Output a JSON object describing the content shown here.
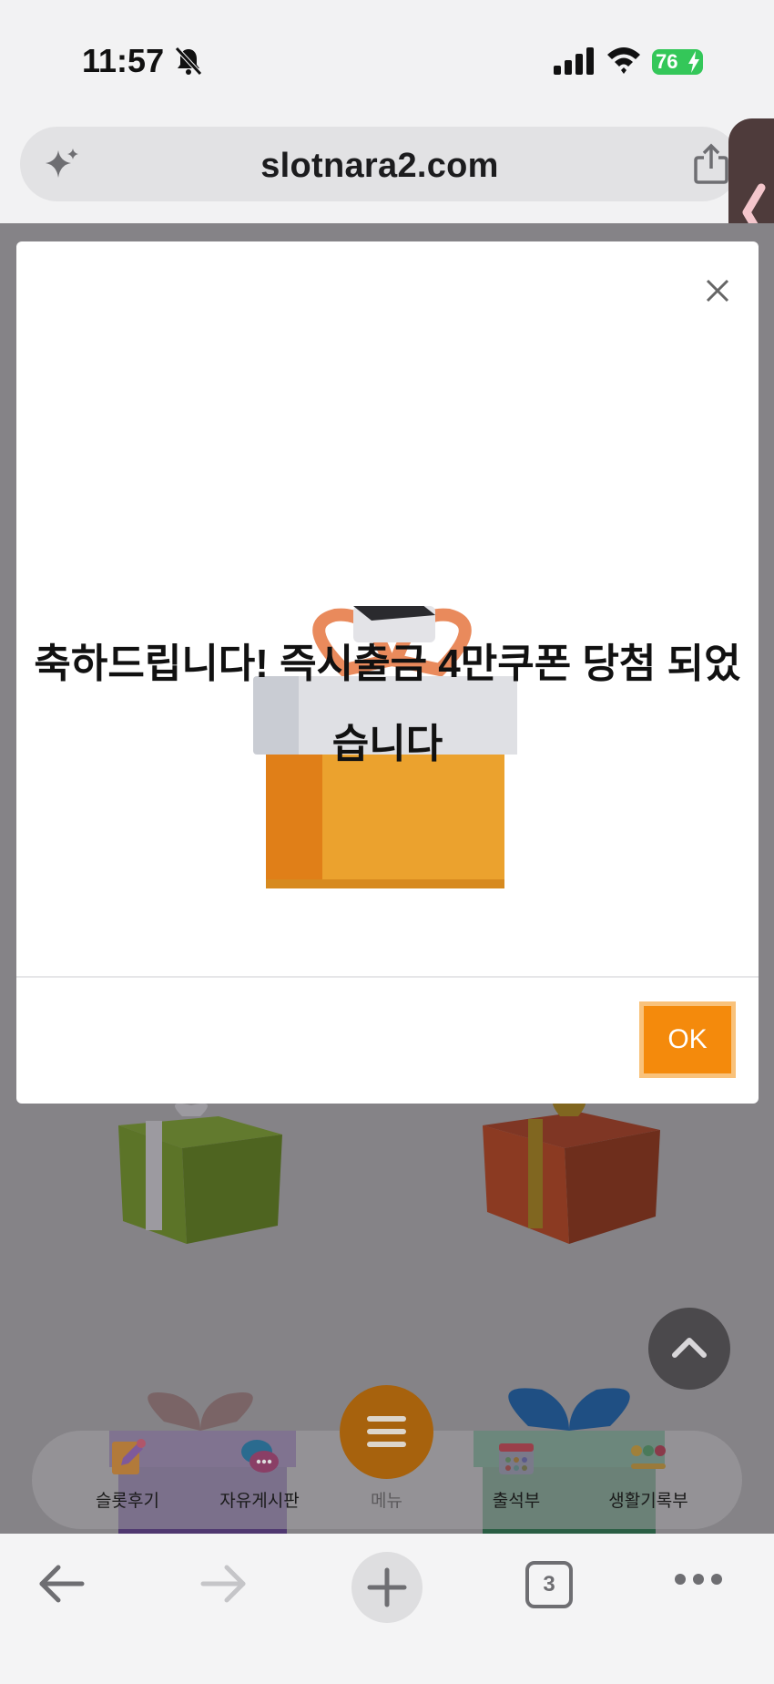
{
  "status_bar": {
    "time": "11:57",
    "battery": "76",
    "icons": [
      "bell-muted-icon",
      "signal-icon",
      "wifi-icon",
      "battery-icon"
    ]
  },
  "browser": {
    "url": "slotnara2.com",
    "icons": [
      "sparkle-icon",
      "share-icon",
      "side-tab-chevron-icon"
    ]
  },
  "modal": {
    "message": "축하드립니다! 즉시출금 4만쿠폰 당첨 되었습니다",
    "ok_label": "OK",
    "accent_color": "#f48a0c"
  },
  "bottom_nav": {
    "items": [
      {
        "label": "슬롯후기",
        "icon": "review-icon"
      },
      {
        "label": "자유게시판",
        "icon": "chat-icon"
      },
      {
        "label": "출석부",
        "icon": "calendar-icon"
      },
      {
        "label": "생활기록부",
        "icon": "emoji-record-icon"
      }
    ],
    "menu_label": "메뉴"
  },
  "toolbar": {
    "tab_count": "3",
    "icons": [
      "back-icon",
      "forward-icon",
      "new-tab-icon",
      "tabs-icon",
      "more-icon"
    ]
  }
}
